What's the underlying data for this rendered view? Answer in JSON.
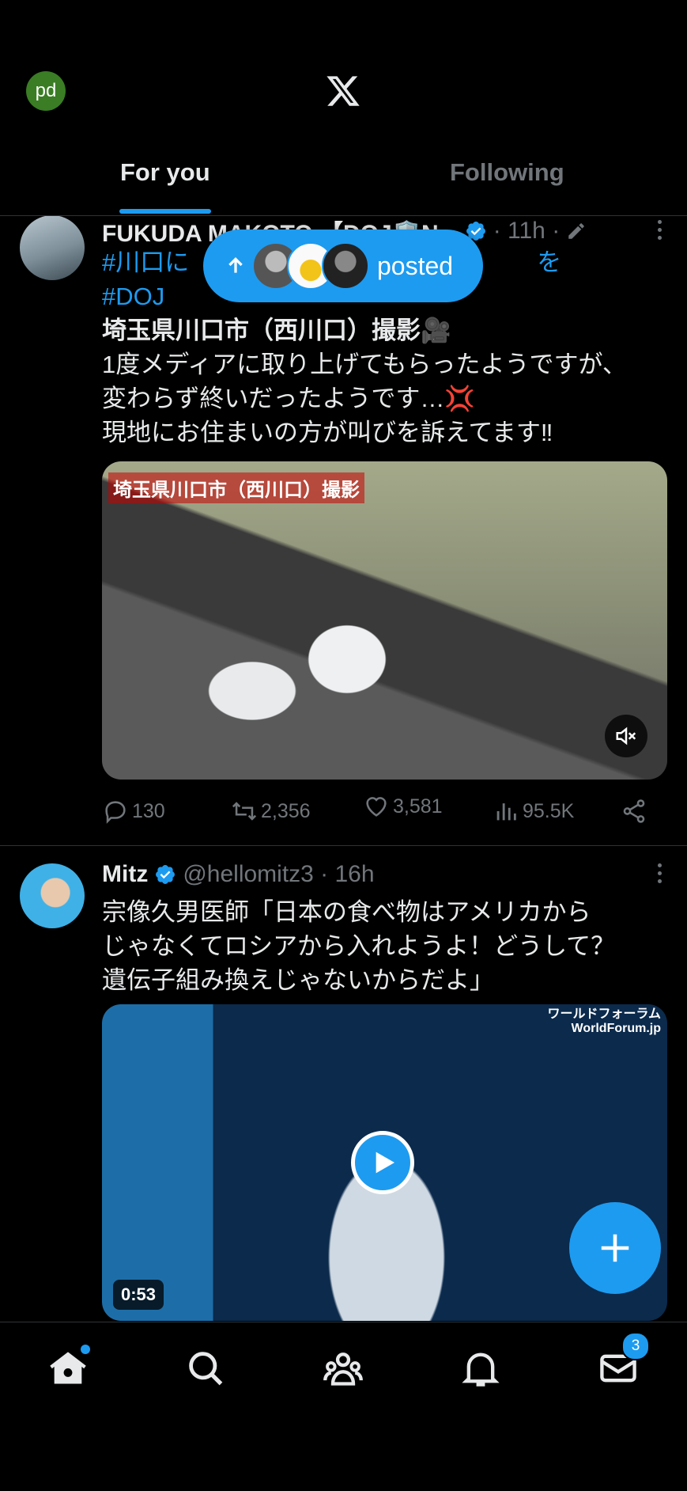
{
  "header": {
    "avatar_initials": "pd",
    "tabs": [
      {
        "label": "For you",
        "active": true
      },
      {
        "label": "Following",
        "active": false
      }
    ]
  },
  "new_posts_pill": {
    "label": "posted"
  },
  "posts": [
    {
      "author": "FUKUDA MAKOTO 【DOJ🛡️N...",
      "verified": true,
      "meta": "· 11h ·",
      "text_line1": "#川口に",
      "text_line1_end": "を",
      "hashtag2": "#DOJ",
      "lines": [
        "埼玉県川口市（西川口）撮影🎥",
        "1度メディアに取り上げてもらったようですが、",
        "変わらず終いだったようです…💢",
        "現地にお住まいの方が叫びを訴えてます‼"
      ],
      "media_caption": "埼玉県川口市（西川口）撮影",
      "replies": "130",
      "reposts": "2,356",
      "likes": "3,581",
      "views": "95.5K"
    },
    {
      "author": "Mitz",
      "verified": true,
      "meta": "@hellomitz3 · 16h",
      "lines": [
        "宗像久男医師「日本の食べ物はアメリカから",
        "じゃなくてロシアから入れようよ！どうして？",
        "遺伝子組み換えじゃないからだよ」"
      ],
      "watermark_line1": "ワールドフォーラム",
      "watermark_line2": "WorldForum.jp",
      "duration": "0:53"
    }
  ],
  "bottom_nav": {
    "items": [
      "home",
      "search",
      "communities",
      "notifications",
      "messages"
    ],
    "messages_badge": "3"
  },
  "colors": {
    "accent": "#1d9bf0",
    "background": "#000000",
    "muted": "#71767b"
  }
}
